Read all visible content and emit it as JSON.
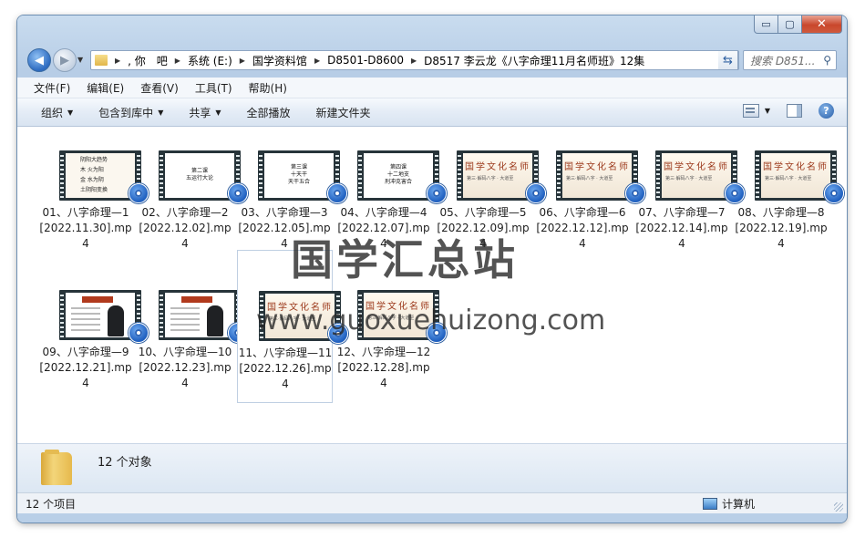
{
  "window": {
    "caption_buttons": {
      "min": "▭",
      "max": "▢",
      "close": "✕"
    }
  },
  "nav": {
    "breadcrumbs": [
      ", 你　吧",
      "系统 (E:)",
      "国学资料馆",
      "D8501-D8600",
      "D8517 李云龙《八字命理11月名师班》12集"
    ],
    "search_placeholder": "搜索 D851..."
  },
  "menubar": [
    "文件(F)",
    "编辑(E)",
    "查看(V)",
    "工具(T)",
    "帮助(H)"
  ],
  "toolbar": {
    "organize": "组织",
    "include_library": "包含到库中",
    "share": "共享",
    "play_all": "全部播放",
    "new_folder": "新建文件夹"
  },
  "files": [
    {
      "name": "01、八字命理—1[2022.11.30].mp4",
      "thumb": "first",
      "lines": [
        "阴阳大趋势",
        "木 火为阳",
        "金 水为阴",
        "土阴阳变换"
      ]
    },
    {
      "name": "02、八字命理—2[2022.12.02].mp4",
      "thumb": "white",
      "lines": [
        "第二课",
        "五运行大论"
      ]
    },
    {
      "name": "03、八字命理—3[2022.12.05].mp4",
      "thumb": "white",
      "lines": [
        "第三课",
        "十天干",
        "天干五合"
      ]
    },
    {
      "name": "04、八字命理—4[2022.12.07].mp4",
      "thumb": "white",
      "lines": [
        "第四课",
        "十二地支",
        "刑冲克害合"
      ]
    },
    {
      "name": "05、八字命理—5[2022.12.09].mp4",
      "thumb": "calligraphy"
    },
    {
      "name": "06、八字命理—6[2022.12.12].mp4",
      "thumb": "calligraphy"
    },
    {
      "name": "07、八字命理—7[2022.12.14].mp4",
      "thumb": "calligraphy"
    },
    {
      "name": "08、八字命理—8[2022.12.19].mp4",
      "thumb": "calligraphy"
    },
    {
      "name": "09、八字命理—9[2022.12.21].mp4",
      "thumb": "person"
    },
    {
      "name": "10、八字命理—10[2022.12.23].mp4",
      "thumb": "person"
    },
    {
      "name": "11、八字命理—11[2022.12.26].mp4",
      "thumb": "calligraphy",
      "selected": true
    },
    {
      "name": "12、八字命理—12[2022.12.28].mp4",
      "thumb": "calligraphy"
    }
  ],
  "calligraphy_text": "国学文化名师",
  "calligraphy_sub": "第三·解码八字 · 大道至",
  "watermark": {
    "cn": "国学汇总站",
    "url": "www.guoxuehuizong.com"
  },
  "details": {
    "count": "12 个对象"
  },
  "status": {
    "left": "12 个项目",
    "right": "计算机"
  },
  "colors": {
    "accent": "#2d6bc1",
    "close": "#c9472c"
  }
}
